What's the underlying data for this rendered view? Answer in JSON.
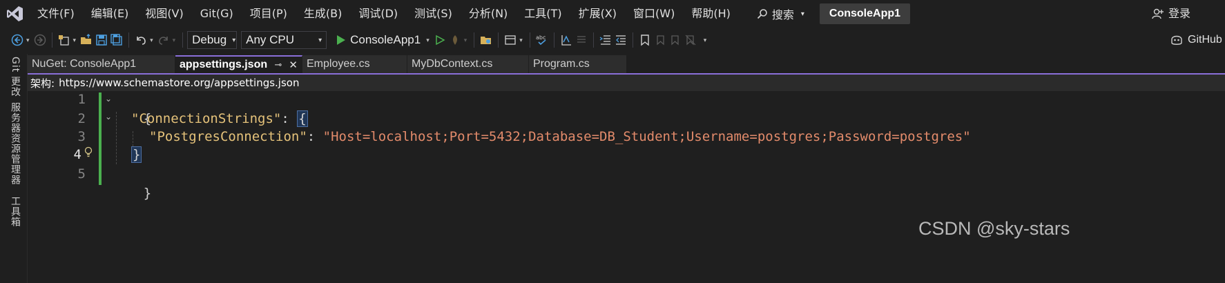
{
  "menubar": {
    "logo_icon": "visual-studio-logo-icon",
    "items": [
      {
        "label": "文件(F)"
      },
      {
        "label": "编辑(E)"
      },
      {
        "label": "视图(V)"
      },
      {
        "label": "Git(G)"
      },
      {
        "label": "项目(P)"
      },
      {
        "label": "生成(B)"
      },
      {
        "label": "调试(D)"
      },
      {
        "label": "测试(S)"
      },
      {
        "label": "分析(N)"
      },
      {
        "label": "工具(T)"
      },
      {
        "label": "扩展(X)"
      },
      {
        "label": "窗口(W)"
      },
      {
        "label": "帮助(H)"
      }
    ],
    "search_label": "搜索",
    "solution_name": "ConsoleApp1",
    "login_label": "登录"
  },
  "toolbar": {
    "configuration": "Debug",
    "platform": "Any CPU",
    "startup_project": "ConsoleApp1",
    "github_label": "GitHub"
  },
  "siderail": {
    "tabs": [
      "Git 更改",
      "服务器资源管理器",
      "工具箱"
    ]
  },
  "tabs": [
    {
      "label": "NuGet: ConsoleApp1",
      "active": false
    },
    {
      "label": "appsettings.json",
      "active": true
    },
    {
      "label": "Employee.cs",
      "active": false
    },
    {
      "label": "MyDbContext.cs",
      "active": false
    },
    {
      "label": "Program.cs",
      "active": false
    }
  ],
  "schema": {
    "label": "架构:",
    "url": "https://www.schemastore.org/appsettings.json"
  },
  "editor": {
    "line_numbers": [
      "1",
      "2",
      "3",
      "4",
      "5"
    ],
    "current_line": 4,
    "lines": {
      "l1_open": "{",
      "l2_key": "\"ConnectionStrings\"",
      "l2_colon": ": ",
      "l2_brace": "{",
      "l3_key": "\"PostgresConnection\"",
      "l3_colon": ": ",
      "l3_value": "\"Host=localhost;Port=5432;Database=DB_Student;Username=postgres;Password=postgres\"",
      "l4_brace": "}",
      "l5_close": "}"
    }
  },
  "watermark": "CSDN @sky-stars",
  "colors": {
    "accent": "#8a6fd9",
    "change_bar": "#4bb04f",
    "json_key": "#e5c27a",
    "json_string": "#e38b6b",
    "run_green": "#4bb04f"
  }
}
